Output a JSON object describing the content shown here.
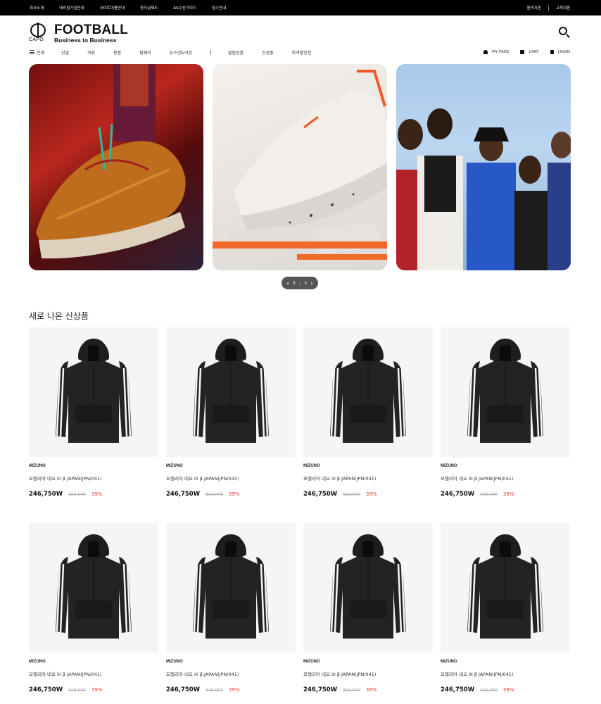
{
  "topbar": {
    "left_links": [
      "회사소개",
      "대리점가입안내",
      "사이트이용안내",
      "등리급제도",
      "AS수선가이드",
      "접수안내"
    ],
    "right_links": [
      "원격지원",
      "고객지원"
    ]
  },
  "logo": {
    "mark": "CAPO",
    "title": "FOOTBALL",
    "subtitle": "Business to Business"
  },
  "search": {
    "icon": "search-icon"
  },
  "nav": {
    "all_label": "전체",
    "categories": [
      "신발",
      "의류",
      "용품",
      "팀웨어",
      "유소년&여성"
    ],
    "extras": [
      "클럽상품",
      "신상품",
      "파격할인전"
    ]
  },
  "util": {
    "my_page": "MY PAGE",
    "cart": "CART",
    "login": "LOGIN"
  },
  "banner": {
    "current": "3",
    "total": "6"
  },
  "section": {
    "title": "새로 나온 신상품"
  },
  "products": [
    {
      "brand": "MIZUNO",
      "name": "모렐리아 네오 III β JAPAN(JPN/041)",
      "price": "246,750W",
      "original": "329,000",
      "discount": "39%"
    },
    {
      "brand": "MIZUNO",
      "name": "모렐리아 네오 III β JAPAN(JPN/041)",
      "price": "246,750W",
      "original": "329,000",
      "discount": "39%"
    },
    {
      "brand": "MIZUNO",
      "name": "모렐리아 네오 III β JAPAN(JPN/041)",
      "price": "246,750W",
      "original": "329,000",
      "discount": "39%"
    },
    {
      "brand": "MIZUNO",
      "name": "모렐리아 네오 III β JAPAN(JPN/041)",
      "price": "246,750W",
      "original": "329,000",
      "discount": "39%"
    },
    {
      "brand": "MIZUNO",
      "name": "모렐리아 네오 III β JAPAN(JPN/041)",
      "price": "246,750W",
      "original": "329,000",
      "discount": "39%"
    },
    {
      "brand": "MIZUNO",
      "name": "모렐리아 네오 III β JAPAN(JPN/041)",
      "price": "246,750W",
      "original": "329,000",
      "discount": "39%"
    },
    {
      "brand": "MIZUNO",
      "name": "모렐리아 네오 III β JAPAN(JPN/041)",
      "price": "246,750W",
      "original": "329,000",
      "discount": "39%"
    },
    {
      "brand": "MIZUNO",
      "name": "모렐리아 네오 III β JAPAN(JPN/041)",
      "price": "246,750W",
      "original": "329,000",
      "discount": "39%"
    }
  ],
  "colors": {
    "topbar_bg": "#000000",
    "discount": "#e8342a",
    "pager_bg": "#555555"
  }
}
